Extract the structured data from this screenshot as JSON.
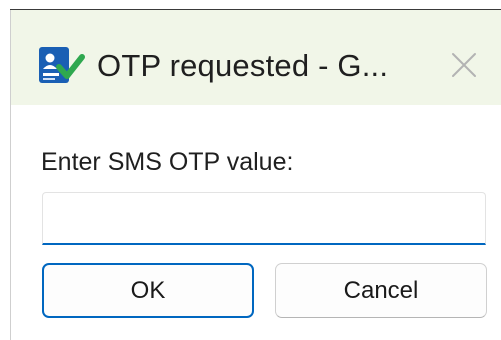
{
  "window": {
    "title": "OTP requested - G...",
    "icon": "contact-sign-check-icon",
    "close_icon": "close-icon"
  },
  "dialog": {
    "prompt": "Enter SMS OTP value:",
    "otp_value": "",
    "otp_placeholder": "",
    "ok_label": "OK",
    "cancel_label": "Cancel"
  },
  "colors": {
    "titlebar_bg": "#f1f6e8",
    "accent": "#0067c0",
    "icon_blue": "#1a5fb4",
    "icon_green": "#2fa84f"
  }
}
